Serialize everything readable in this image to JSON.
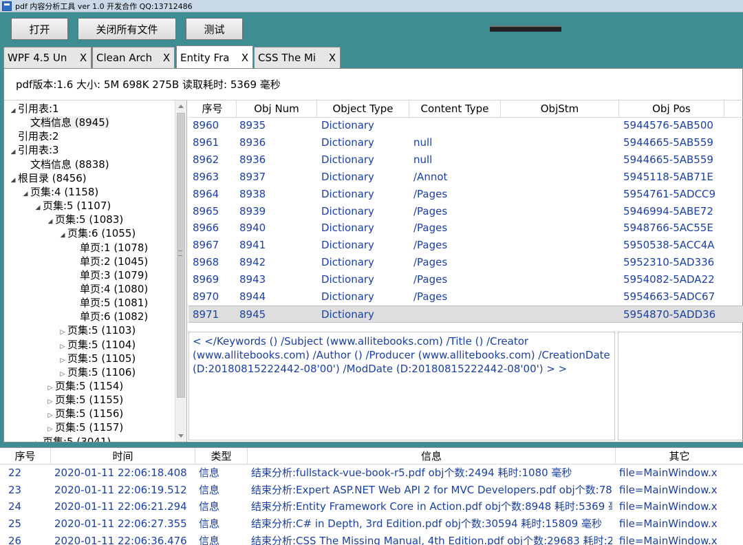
{
  "window": {
    "title": "pdf 内容分析工具 ver 1.0   开发合作 QQ:13712486"
  },
  "toolbar": {
    "open_label": "打开",
    "close_all_label": "关闭所有文件",
    "test_label": "测试"
  },
  "tabs": [
    {
      "label": "WPF 4.5 Un",
      "close": "X"
    },
    {
      "label": "Clean Arch",
      "close": "X"
    },
    {
      "label": "Entity Fra",
      "close": "X"
    },
    {
      "label": "CSS The Mi",
      "close": "X"
    }
  ],
  "info": {
    "text": "pdf版本:1.6  大小: 5M 698K 275B  读取耗时: 5369 毫秒"
  },
  "tree": [
    {
      "label": "引用表:1",
      "toggle": "◢",
      "depth": 0
    },
    {
      "label": "文档信息 (8945)",
      "toggle": "",
      "depth": 1
    },
    {
      "label": "引用表:2",
      "toggle": "",
      "depth": 0
    },
    {
      "label": "引用表:3",
      "toggle": "◢",
      "depth": 0
    },
    {
      "label": "文档信息 (8838)",
      "toggle": "",
      "depth": 1
    },
    {
      "label": "根目录 (8456)",
      "toggle": "◢",
      "depth": 0
    },
    {
      "label": "页集:4 (1158)",
      "toggle": "◢",
      "depth": 1
    },
    {
      "label": "页集:5 (1107)",
      "toggle": "◢",
      "depth": 2
    },
    {
      "label": "页集:5 (1083)",
      "toggle": "◢",
      "depth": 3
    },
    {
      "label": "页集:6 (1055)",
      "toggle": "◢",
      "depth": 4
    },
    {
      "label": "单页:1 (1078)",
      "toggle": "",
      "depth": 5
    },
    {
      "label": "单页:2 (1045)",
      "toggle": "",
      "depth": 5
    },
    {
      "label": "单页:3 (1079)",
      "toggle": "",
      "depth": 5
    },
    {
      "label": "单页:4 (1080)",
      "toggle": "",
      "depth": 5
    },
    {
      "label": "单页:5 (1081)",
      "toggle": "",
      "depth": 5
    },
    {
      "label": "单页:6 (1082)",
      "toggle": "",
      "depth": 5
    },
    {
      "label": "页集:5 (1103)",
      "toggle": "▷",
      "depth": 4
    },
    {
      "label": "页集:5 (1104)",
      "toggle": "▷",
      "depth": 4
    },
    {
      "label": "页集:5 (1105)",
      "toggle": "▷",
      "depth": 4
    },
    {
      "label": "页集:5 (1106)",
      "toggle": "▷",
      "depth": 4
    },
    {
      "label": "页集:5 (1154)",
      "toggle": "▷",
      "depth": 3
    },
    {
      "label": "页集:5 (1155)",
      "toggle": "▷",
      "depth": 3
    },
    {
      "label": "页集:5 (1156)",
      "toggle": "▷",
      "depth": 3
    },
    {
      "label": "页集:5 (1157)",
      "toggle": "▷",
      "depth": 3
    },
    {
      "label": "页集:5 (3041)",
      "toggle": "▷",
      "depth": 2
    }
  ],
  "grid": {
    "columns": [
      "序号",
      "Obj Num",
      "Object Type",
      "Content Type",
      "ObjStm",
      "Obj Pos"
    ],
    "rows": [
      [
        "8960",
        "8935",
        "Dictionary",
        "",
        "",
        "5944576-5AB500"
      ],
      [
        "8961",
        "8936",
        "Dictionary",
        "null",
        "",
        "5944665-5AB559"
      ],
      [
        "8962",
        "8936",
        "Dictionary",
        "null",
        "",
        "5944665-5AB559"
      ],
      [
        "8963",
        "8937",
        "Dictionary",
        "/Annot",
        "",
        "5945118-5AB71E"
      ],
      [
        "8964",
        "8938",
        "Dictionary",
        "/Pages",
        "",
        "5954761-5ADCC9"
      ],
      [
        "8965",
        "8939",
        "Dictionary",
        "/Pages",
        "",
        "5946994-5ABE72"
      ],
      [
        "8966",
        "8940",
        "Dictionary",
        "/Pages",
        "",
        "5948766-5AC55E"
      ],
      [
        "8967",
        "8941",
        "Dictionary",
        "/Pages",
        "",
        "5950538-5ACC4A"
      ],
      [
        "8968",
        "8942",
        "Dictionary",
        "/Pages",
        "",
        "5952310-5AD336"
      ],
      [
        "8969",
        "8943",
        "Dictionary",
        "/Pages",
        "",
        "5954082-5ADA22"
      ],
      [
        "8970",
        "8944",
        "Dictionary",
        "/Pages",
        "",
        "5954663-5ADC67"
      ],
      [
        "8971",
        "8945",
        "Dictionary",
        "",
        "",
        "5954870-5ADD36"
      ]
    ]
  },
  "detail": {
    "text": "< </Keywords () /Subject (www.allitebooks.com) /Title () /Creator (www.allitebooks.com) /Author () /Producer (www.allitebooks.com) /CreationDate (D:20180815222442-08'00') /ModDate (D:20180815222442-08'00') > >"
  },
  "log": {
    "columns": [
      "序号",
      "时间",
      "类型",
      "信息",
      "其它"
    ],
    "rows": [
      [
        "22",
        "2020-01-11 22:06:18.408",
        "信息",
        "结束分析:fullstack-vue-book-r5.pdf obj个数:2494 耗时:1080 毫秒",
        "file=MainWindow.x"
      ],
      [
        "23",
        "2020-01-11 22:06:19.512",
        "信息",
        "结束分析:Expert ASP.NET Web API 2 for MVC Developers.pdf obj个数:78",
        "file=MainWindow.x"
      ],
      [
        "24",
        "2020-01-11 22:06:21.294",
        "信息",
        "结束分析:Entity Framework Core in Action.pdf obj个数:8948 耗时:5369 毫",
        "file=MainWindow.x"
      ],
      [
        "25",
        "2020-01-11 22:06:27.355",
        "信息",
        "结束分析:C# in Depth, 3rd Edition.pdf obj个数:30594 耗时:15809 毫秒",
        "file=MainWindow.x"
      ],
      [
        "26",
        "2020-01-11 22:06:36.476",
        "信息",
        "结束分析:CSS The Missing Manual, 4th Edition.pdf obj个数:29683 耗时:24",
        "file=MainWindow.x"
      ]
    ]
  }
}
